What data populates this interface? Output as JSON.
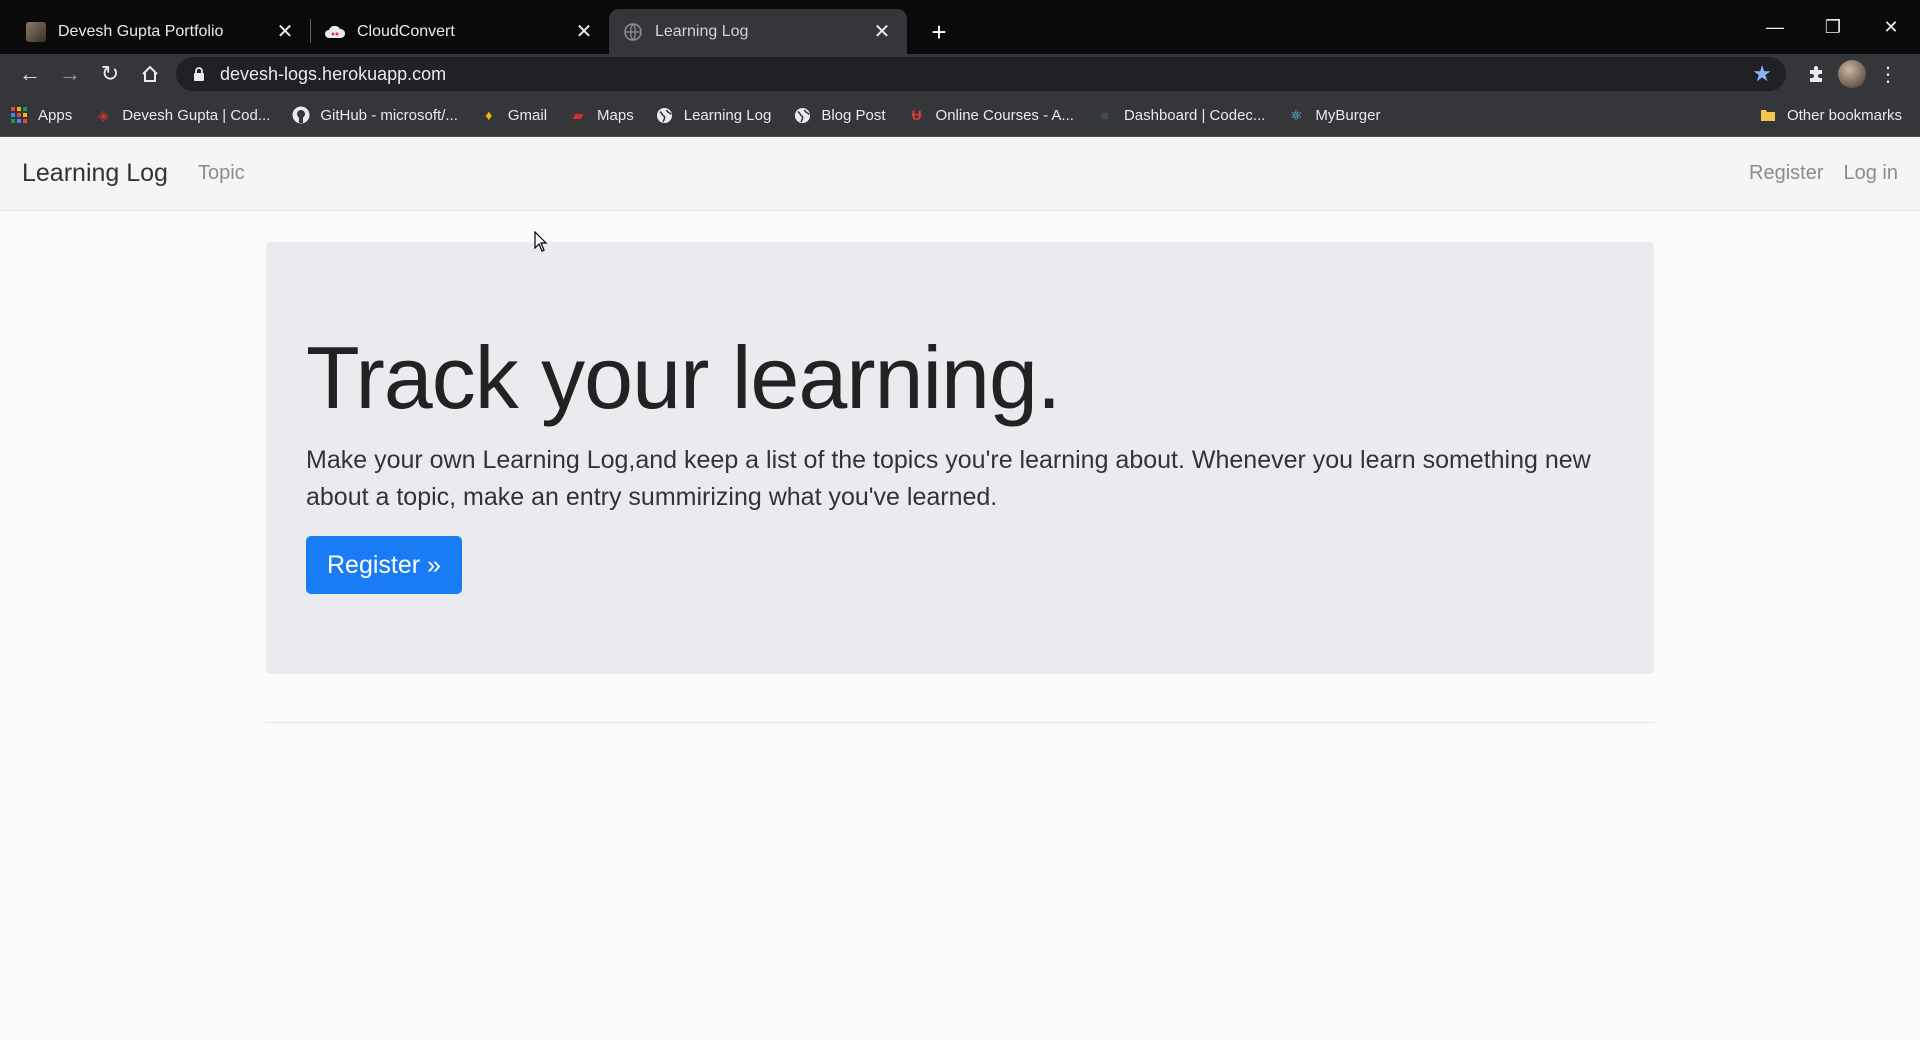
{
  "tabs": [
    {
      "title": "Devesh Gupta Portfolio",
      "icon": "portfolio-favicon-icon"
    },
    {
      "title": "CloudConvert",
      "icon": "cloudconvert-icon"
    },
    {
      "title": "Learning Log",
      "icon": "globe-icon"
    }
  ],
  "address": {
    "url": "devesh-logs.herokuapp.com"
  },
  "bookmarks": [
    {
      "label": "Apps",
      "icon": "apps-grid-icon"
    },
    {
      "label": "Devesh Gupta | Cod...",
      "icon": "codechef-icon"
    },
    {
      "label": "GitHub - microsoft/...",
      "icon": "github-icon"
    },
    {
      "label": "Gmail",
      "icon": "gmail-icon"
    },
    {
      "label": "Maps",
      "icon": "maps-icon"
    },
    {
      "label": "Learning Log",
      "icon": "globe-icon"
    },
    {
      "label": "Blog Post",
      "icon": "globe-icon"
    },
    {
      "label": "Online Courses - A...",
      "icon": "udemy-icon"
    },
    {
      "label": "Dashboard | Codec...",
      "icon": "dashboard-icon"
    },
    {
      "label": "MyBurger",
      "icon": "react-icon"
    }
  ],
  "other_bookmarks": "Other bookmarks",
  "site": {
    "brand": "Learning Log",
    "nav_topic": "Topic",
    "nav_register": "Register",
    "nav_login": "Log in"
  },
  "hero": {
    "title": "Track your learning.",
    "lead": "Make your own Learning Log,and keep a list of the topics you're learning about. Whenever you learn something new about a topic, make an entry summirizing what you've learned.",
    "button": "Register »"
  },
  "colors": {
    "primary_button": "#1a7cf5",
    "jumbotron_bg": "#e9ebee",
    "chrome_dark": "#35363a"
  }
}
